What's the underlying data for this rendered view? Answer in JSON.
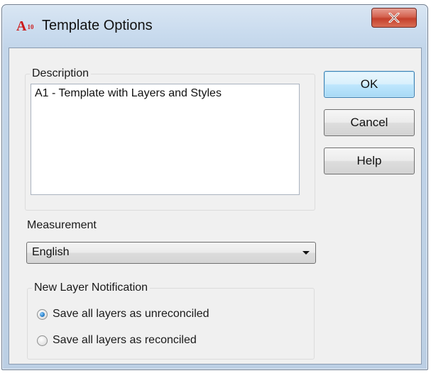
{
  "window": {
    "app_icon_text": "A",
    "app_icon_sub": "10",
    "title": "Template Options",
    "close_glyph": "X"
  },
  "description": {
    "label": "Description",
    "value": "A1 - Template with Layers and Styles"
  },
  "buttons": {
    "ok": "OK",
    "cancel": "Cancel",
    "help": "Help"
  },
  "measurement": {
    "label": "Measurement",
    "selected": "English"
  },
  "notification": {
    "label": "New Layer Notification",
    "options": [
      {
        "label": "Save all layers as unreconciled",
        "selected": true
      },
      {
        "label": "Save all layers as reconciled",
        "selected": false
      }
    ]
  },
  "colors": {
    "close_button": "#c4402c",
    "default_button_border": "#3c7fb1",
    "app_icon": "#cc1a1a"
  }
}
